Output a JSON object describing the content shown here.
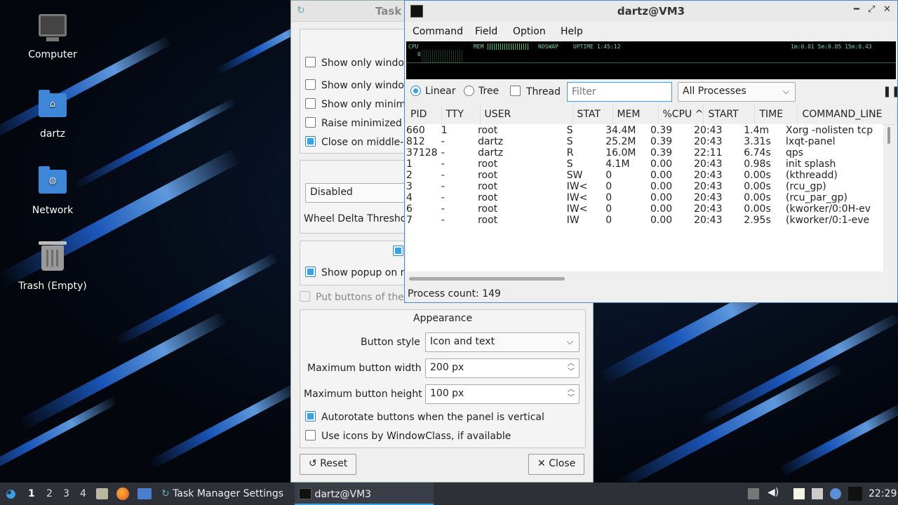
{
  "desktop": {
    "icons": [
      {
        "label": "Computer",
        "icon": "computer-icon"
      },
      {
        "label": "dartz",
        "icon": "home-folder-icon"
      },
      {
        "label": "Network",
        "icon": "network-folder-icon"
      },
      {
        "label": "Trash (Empty)",
        "icon": "trash-icon"
      }
    ]
  },
  "settings_window": {
    "title": "Task",
    "checks": [
      {
        "label": "Show only window",
        "checked": false
      },
      {
        "label": "Show only window",
        "checked": false
      },
      {
        "label": "Show only minimi",
        "checked": false
      },
      {
        "label": "Raise minimized v",
        "checked": false
      },
      {
        "label": "Close on middle-c",
        "checked": true
      }
    ],
    "scroll_combo": "Disabled",
    "wheel_label": "Wheel Delta Thresho",
    "popup_check": "Show popup on m",
    "put_buttons": "Put buttons of the",
    "appearance": {
      "title": "Appearance",
      "button_style_label": "Button style",
      "button_style_value": "Icon and text",
      "max_width_label": "Maximum button width",
      "max_width_value": "200 px",
      "max_height_label": "Maximum button height",
      "max_height_value": "100 px",
      "autorotate": "Autorotate buttons when the panel is vertical",
      "wmclass": "Use icons by WindowClass, if available"
    },
    "reset_label": "Reset",
    "close_label": "Close"
  },
  "qps": {
    "title": "dartz@VM3",
    "menu": [
      "Command",
      "Field",
      "Option",
      "Help"
    ],
    "info": {
      "cpu": "CPU",
      "cpu_zero": "0",
      "mem": "MEM",
      "noswap": "NOSWAP",
      "uptime": "UPTIME 1:45:12",
      "load": "1m:0.01 5m:0.05 15m:0.43"
    },
    "view_modes": [
      "Linear",
      "Tree",
      "Thread"
    ],
    "filter_placeholder": "Filter",
    "process_scope": "All Processes",
    "pause_icon": "pause-icon",
    "columns": [
      "PID",
      "TTY",
      "USER",
      "STAT",
      "MEM",
      "%CPU",
      "START",
      "TIME",
      "COMMAND_LINE"
    ],
    "sort_indicator": "^",
    "rows": [
      [
        "660",
        "1",
        "root",
        "S",
        "34.4M",
        "0.39",
        "20:43",
        "1.4m",
        "Xorg -nolisten tcp"
      ],
      [
        "812",
        "-",
        "dartz",
        "S",
        "25.2M",
        "0.39",
        "20:43",
        "3.31s",
        "lxqt-panel"
      ],
      [
        "37128",
        "-",
        "dartz",
        "R",
        "16.0M",
        "0.39",
        "22:11",
        "6.74s",
        "qps"
      ],
      [
        "1",
        "-",
        "root",
        "S",
        "4.1M",
        "0.00",
        "20:43",
        "0.98s",
        "init splash"
      ],
      [
        "2",
        "-",
        "root",
        "SW",
        "0",
        "0.00",
        "20:43",
        "0.00s",
        "(kthreadd)"
      ],
      [
        "3",
        "-",
        "root",
        "IW<",
        "0",
        "0.00",
        "20:43",
        "0.00s",
        "(rcu_gp)"
      ],
      [
        "4",
        "-",
        "root",
        "IW<",
        "0",
        "0.00",
        "20:43",
        "0.00s",
        "(rcu_par_gp)"
      ],
      [
        "6",
        "-",
        "root",
        "IW<",
        "0",
        "0.00",
        "20:43",
        "0.00s",
        "(kworker/0:0H-ev"
      ],
      [
        "7",
        "-",
        "root",
        "IW",
        "0",
        "0.00",
        "20:43",
        "2.95s",
        "(kworker/0:1-eve"
      ]
    ],
    "status": "Process count: 149"
  },
  "taskbar": {
    "workspaces": [
      "1",
      "2",
      "3",
      "4"
    ],
    "tasks": [
      "Task Manager Settings",
      "dartz@VM3"
    ],
    "clock": "22:29"
  },
  "colors": {
    "accent": "#35a3e6",
    "taskbar": "#2d3036",
    "wallpaper_blue": "#1e63d6"
  }
}
